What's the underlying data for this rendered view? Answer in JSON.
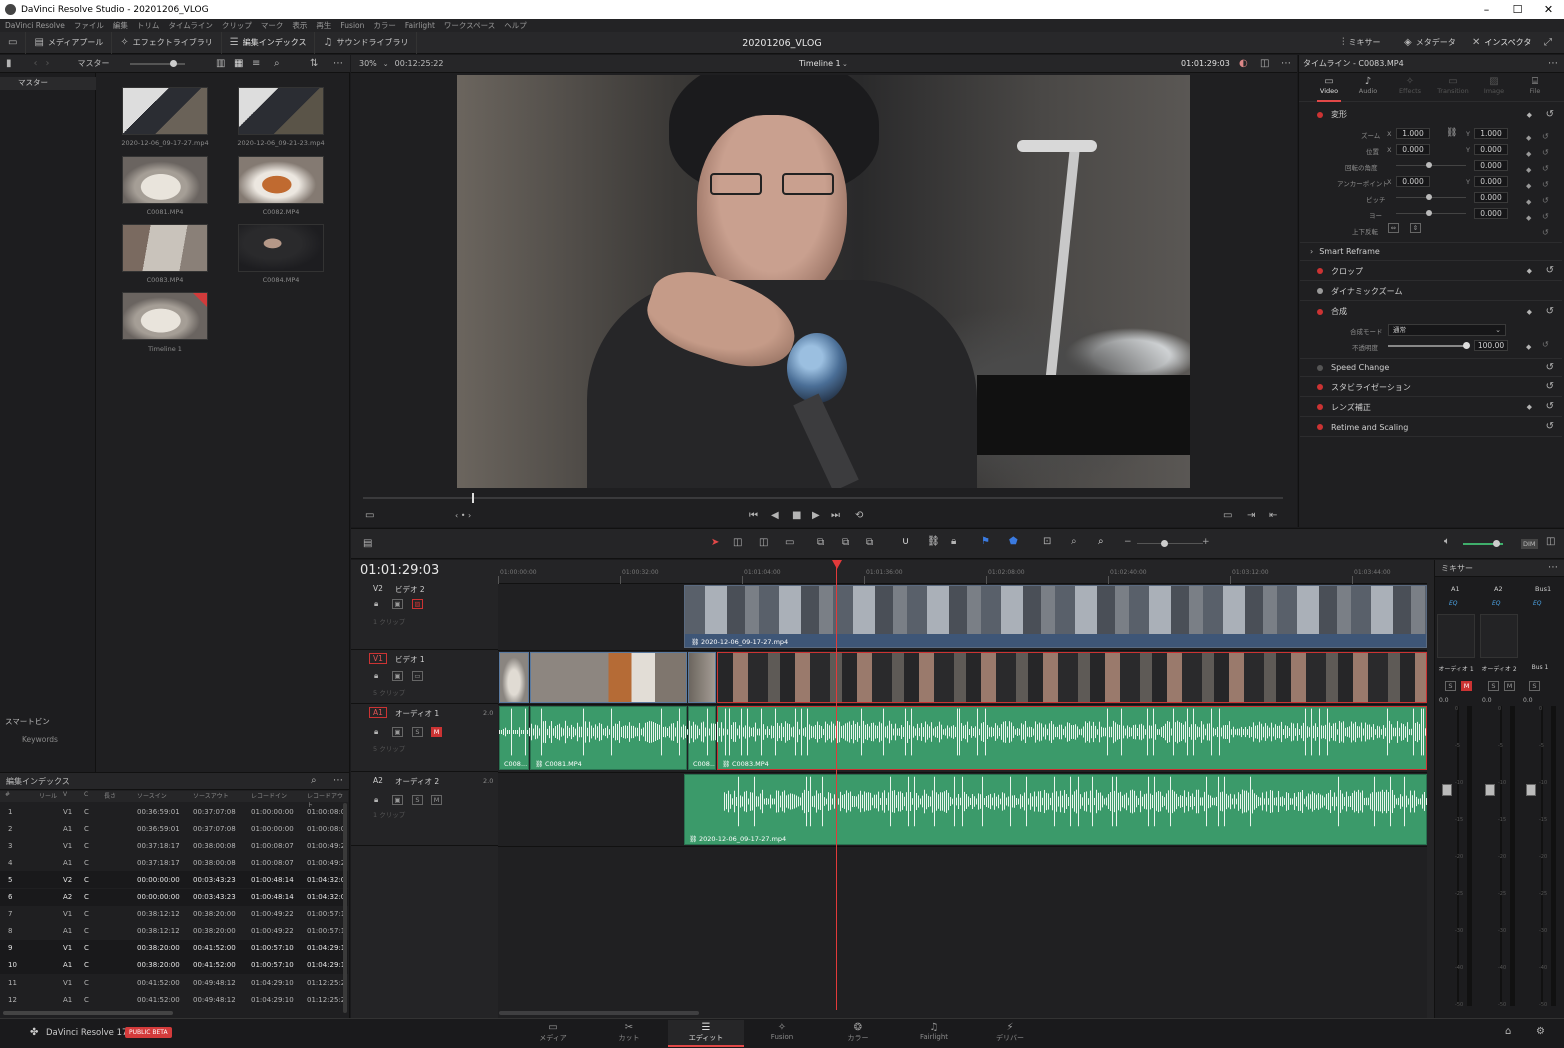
{
  "window": {
    "title": "DaVinci Resolve Studio - 20201206_VLOG",
    "min": "–",
    "max": "☐",
    "close": "✕"
  },
  "menu": [
    "DaVinci Resolve",
    "ファイル",
    "編集",
    "トリム",
    "タイムライン",
    "クリップ",
    "マーク",
    "表示",
    "再生",
    "Fusion",
    "カラー",
    "Fairlight",
    "ワークスペース",
    "ヘルプ"
  ],
  "toolbar": {
    "media_pool": "メディアプール",
    "effects_library": "エフェクトライブラリ",
    "edit_index": "編集インデックス",
    "sound_library": "サウンドライブラリ",
    "project_title": "20201206_VLOG",
    "mixer": "ミキサー",
    "metadata": "メタデータ",
    "inspector": "インスペクタ"
  },
  "media_pool": {
    "bin_label": "マスター",
    "tree_master": "マスター",
    "smart_bins": "スマートビン",
    "keywords": "Keywords",
    "clips": [
      {
        "name": "2020-12-06_09-17-27.mp4",
        "kind": "screen"
      },
      {
        "name": "2020-12-06_09-21-23.mp4",
        "kind": "screen"
      },
      {
        "name": "C0081.MP4",
        "kind": "bowl"
      },
      {
        "name": "C0082.MP4",
        "kind": "food"
      },
      {
        "name": "C0083.MP4",
        "kind": "hand"
      },
      {
        "name": "C0084.MP4",
        "kind": "person"
      },
      {
        "name": "Timeline 1",
        "kind": "timeline"
      }
    ]
  },
  "viewer": {
    "zoom": "30%",
    "source_tc": "00:12:25:22",
    "timeline_name": "Timeline 1",
    "record_tc": "01:01:29:03"
  },
  "inspector": {
    "header": "タイムライン - C0083.MP4",
    "tabs": [
      "Video",
      "Audio",
      "Effects",
      "Transition",
      "Image",
      "File"
    ],
    "transform": "変形",
    "zoom_label": "ズーム",
    "zoom_x": "1.000",
    "zoom_y": "1.000",
    "position_label": "位置",
    "pos_x": "0.000",
    "pos_y": "0.000",
    "rotation_label": "回転の角度",
    "rotation": "0.000",
    "anchor_label": "アンカーポイント",
    "anchor_x": "0.000",
    "anchor_y": "0.000",
    "pitch_label": "ピッチ",
    "pitch": "0.000",
    "yaw_label": "ヨー",
    "yaw": "0.000",
    "flip_label": "上下反転",
    "smart_reframe": "Smart Reframe",
    "crop": "クロップ",
    "dynamic_zoom": "ダイナミックズーム",
    "composite": "合成",
    "composite_mode_label": "合成モード",
    "composite_mode": "通常",
    "opacity_label": "不透明度",
    "opacity": "100.00",
    "speed_change": "Speed Change",
    "stabilization": "スタビライゼーション",
    "lens_correction": "レンズ補正",
    "retime_scaling": "Retime and Scaling",
    "x": "X",
    "y": "Y"
  },
  "timeline": {
    "timecode": "01:01:29:03",
    "ruler": [
      "01:00:00:00",
      "01:00:32:00",
      "01:01:04:00",
      "01:01:36:00",
      "01:02:08:00",
      "01:02:40:00",
      "01:03:12:00",
      "01:03:44:00"
    ],
    "tracks": [
      {
        "id": "V2",
        "name": "ビデオ 2",
        "count": "1 クリップ"
      },
      {
        "id": "V1",
        "name": "ビデオ 1",
        "count": "5 クリップ"
      },
      {
        "id": "A1",
        "name": "オーディオ 1",
        "count": "5 クリップ",
        "ch": "2.0"
      },
      {
        "id": "A2",
        "name": "オーディオ 2",
        "count": "1 クリップ",
        "ch": "2.0"
      }
    ],
    "clips": {
      "v2": "2020-12-06_09-17-27.mp4",
      "a1_1": "C008...",
      "a1_2": "C0081.MP4",
      "a1_3": "C008...",
      "a1_4": "C0083.MP4",
      "a2": "2020-12-06_09-17-27.mp4"
    },
    "btn_s": "S",
    "btn_m": "M",
    "dim": "DIM"
  },
  "mixer": {
    "title": "ミキサー",
    "channels": [
      "A1",
      "A2",
      "Bus1"
    ],
    "eq": "EQ",
    "strip_names": [
      "オーディオ 1",
      "オーディオ 2",
      "Bus 1"
    ],
    "db_top": "0.0",
    "scale": [
      "0",
      "-5",
      "-10",
      "-15",
      "-20",
      "-25",
      "-30",
      "-40",
      "-50"
    ]
  },
  "edit_index": {
    "title": "編集インデックス",
    "columns": [
      "#",
      "リール",
      "V",
      "C",
      "長さ",
      "ソースイン",
      "ソースアウト",
      "レコードイン",
      "レコードアウト"
    ],
    "rows": [
      [
        "1",
        "V1",
        "C",
        "00:36:59:01",
        "00:37:07:08",
        "01:00:00:00",
        "01:00:08:0"
      ],
      [
        "2",
        "A1",
        "C",
        "00:36:59:01",
        "00:37:07:08",
        "01:00:00:00",
        "01:00:08:0"
      ],
      [
        "3",
        "V1",
        "C",
        "00:37:18:17",
        "00:38:00:08",
        "01:00:08:07",
        "01:00:49:2"
      ],
      [
        "4",
        "A1",
        "C",
        "00:37:18:17",
        "00:38:00:08",
        "01:00:08:07",
        "01:00:49:2"
      ],
      [
        "5",
        "V2",
        "C",
        "00:00:00:00",
        "00:03:43:23",
        "01:00:48:14",
        "01:04:32:0"
      ],
      [
        "6",
        "A2",
        "C",
        "00:00:00:00",
        "00:03:43:23",
        "01:00:48:14",
        "01:04:32:0"
      ],
      [
        "7",
        "V1",
        "C",
        "00:38:12:12",
        "00:38:20:00",
        "01:00:49:22",
        "01:00:57:1"
      ],
      [
        "8",
        "A1",
        "C",
        "00:38:12:12",
        "00:38:20:00",
        "01:00:49:22",
        "01:00:57:1"
      ],
      [
        "9",
        "V1",
        "C",
        "00:38:20:00",
        "00:41:52:00",
        "01:00:57:10",
        "01:04:29:1"
      ],
      [
        "10",
        "A1",
        "C",
        "00:38:20:00",
        "00:41:52:00",
        "01:00:57:10",
        "01:04:29:1"
      ],
      [
        "11",
        "V1",
        "C",
        "00:41:52:00",
        "00:49:48:12",
        "01:04:29:10",
        "01:12:25:2"
      ],
      [
        "12",
        "A1",
        "C",
        "00:41:52:00",
        "00:49:48:12",
        "01:04:29:10",
        "01:12:25:2"
      ]
    ]
  },
  "footer": {
    "app": "DaVinci Resolve 17",
    "badge": "PUBLIC BETA",
    "pages": [
      "メディア",
      "カット",
      "エディット",
      "Fusion",
      "カラー",
      "Fairlight",
      "デリバー"
    ],
    "active_page": "エディット"
  }
}
